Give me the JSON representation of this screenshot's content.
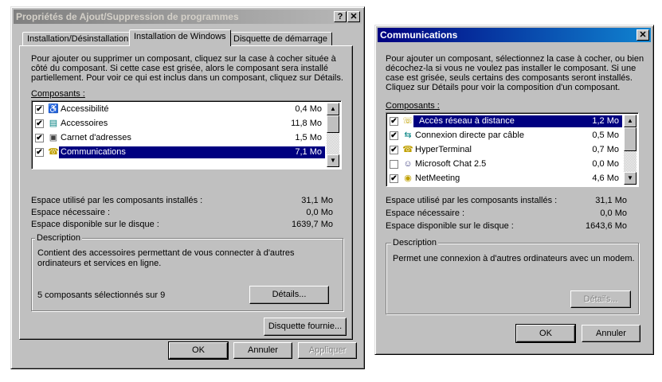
{
  "dialog1": {
    "title": "Propriétés de Ajout/Suppression de programmes",
    "help_btn": "?",
    "close_btn": "✕",
    "tabs": [
      "Installation/Désinstallation",
      "Installation de Windows",
      "Disquette de démarrage"
    ],
    "intro": [
      "Pour ajouter ou supprimer un composant, cliquez sur la case à cocher située à",
      "côté du composant. Si cette case est grisée, alors le composant sera installé",
      "partiellement. Pour voir ce qui est inclus dans un composant, cliquez sur Détails."
    ],
    "components_label": "Composants :",
    "items": [
      {
        "label": "Accessibilité",
        "size": "0,4 Mo",
        "checked": "✔",
        "icon": "accessibility-icon",
        "glyph": "♿"
      },
      {
        "label": "Accessoires",
        "size": "11,8 Mo",
        "checked": "✔",
        "icon": "accessories-icon",
        "glyph": "▤"
      },
      {
        "label": "Carnet d'adresses",
        "size": "1,5 Mo",
        "checked": "✔",
        "icon": "address-book-icon",
        "glyph": "▣"
      },
      {
        "label": "Communications",
        "size": "7,1 Mo",
        "checked": "✔",
        "icon": "communications-icon",
        "glyph": "☎"
      }
    ],
    "used_label": "Espace utilisé par les composants installés :",
    "used_value": "31,1 Mo",
    "needed_label": "Espace nécessaire :",
    "needed_value": "0,0 Mo",
    "free_label": "Espace disponible sur le disque :",
    "free_value": "1639,7 Mo",
    "desc_label": "Description",
    "desc_text": [
      "Contient des accessoires permettant de vous connecter à d'autres",
      "ordinateurs et services en ligne."
    ],
    "selected_text": "5 composants sélectionnés sur 9",
    "details_btn": "Détails...",
    "disk_btn": "Disquette fournie...",
    "ok_btn": "OK",
    "cancel_btn": "Annuler",
    "apply_btn": "Appliquer"
  },
  "dialog2": {
    "title": "Communications",
    "close_btn": "✕",
    "intro": [
      "Pour ajouter un composant, sélectionnez la case à cocher, ou bien",
      "décochez-la si vous ne voulez pas installer le composant. Si une",
      "case est grisée, seuls certains des composants seront installés.",
      "Cliquez sur Détails pour voir la composition d'un composant."
    ],
    "components_label": "Composants :",
    "items": [
      {
        "label": "Accès réseau à distance",
        "size": "1,2 Mo",
        "checked": "✔",
        "icon": "dialup-icon",
        "glyph": "☏"
      },
      {
        "label": "Connexion directe par câble",
        "size": "0,5 Mo",
        "checked": "✔",
        "icon": "cable-icon",
        "glyph": "⇆"
      },
      {
        "label": "HyperTerminal",
        "size": "0,7 Mo",
        "checked": "✔",
        "icon": "hyperterminal-icon",
        "glyph": "☎"
      },
      {
        "label": "Microsoft Chat 2.5",
        "size": "0,0 Mo",
        "checked": "",
        "icon": "chat-icon",
        "glyph": "☺"
      },
      {
        "label": "NetMeeting",
        "size": "4,6 Mo",
        "checked": "✔",
        "icon": "netmeeting-icon",
        "glyph": "◉"
      }
    ],
    "used_label": "Espace utilisé par les composants installés :",
    "used_value": "31,1 Mo",
    "needed_label": "Espace nécessaire :",
    "needed_value": "0,0 Mo",
    "free_label": "Espace disponible sur le disque :",
    "free_value": "1643,6 Mo",
    "desc_label": "Description",
    "desc_text": "Permet une connexion à d'autres ordinateurs avec un modem.",
    "details_btn": "Détails...",
    "ok_btn": "OK",
    "cancel_btn": "Annuler"
  }
}
